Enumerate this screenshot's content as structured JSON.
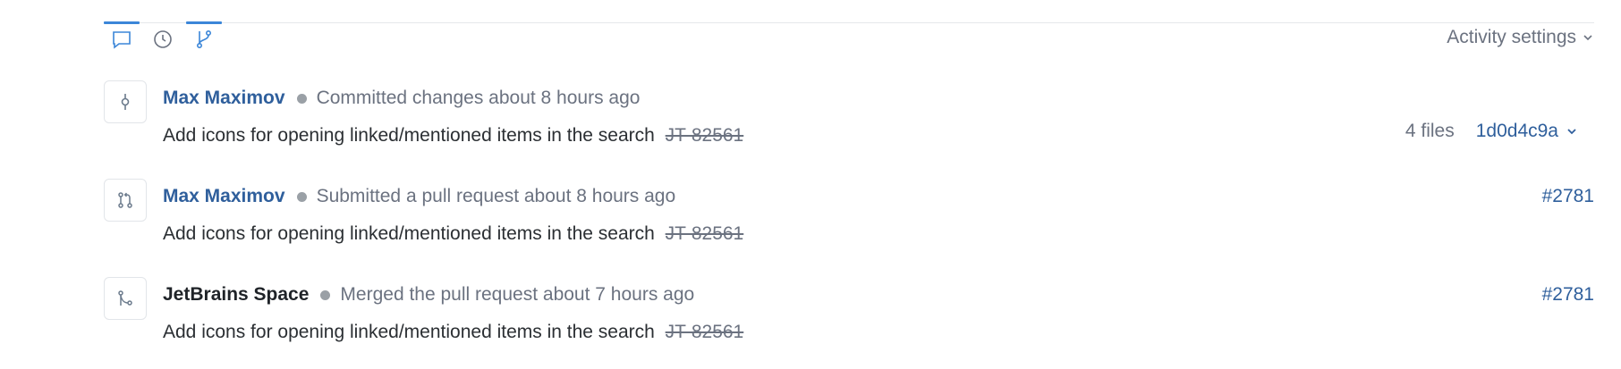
{
  "tabs": [
    {
      "icon": "comment-icon",
      "active": true
    },
    {
      "icon": "clock-icon",
      "active": false
    },
    {
      "icon": "branch-icon",
      "active": true
    }
  ],
  "settings": {
    "label": "Activity settings"
  },
  "activity": [
    {
      "icon": "commit-icon",
      "author": "Max Maximov",
      "action": "Committed changes about 8 hours ago",
      "message": "Add icons for opening linked/mentioned items in the search",
      "issue": "JT-82561",
      "files": "4 files",
      "hash": "1d0d4c9a"
    },
    {
      "icon": "pull-request-icon",
      "author": "Max Maximov",
      "action": "Submitted a pull request about 8 hours ago",
      "message": "Add icons for opening linked/mentioned items in the search",
      "issue": "JT-82561",
      "link": "#2781"
    },
    {
      "icon": "merge-icon",
      "author": "JetBrains Space",
      "action": "Merged the pull request about 7 hours ago",
      "message": "Add icons for opening linked/mentioned items in the search",
      "issue": "JT-82561",
      "link": "#2781"
    }
  ],
  "colors": {
    "accent": "#3b86d8",
    "link": "#2f5f9c",
    "muted": "#6b7280"
  }
}
